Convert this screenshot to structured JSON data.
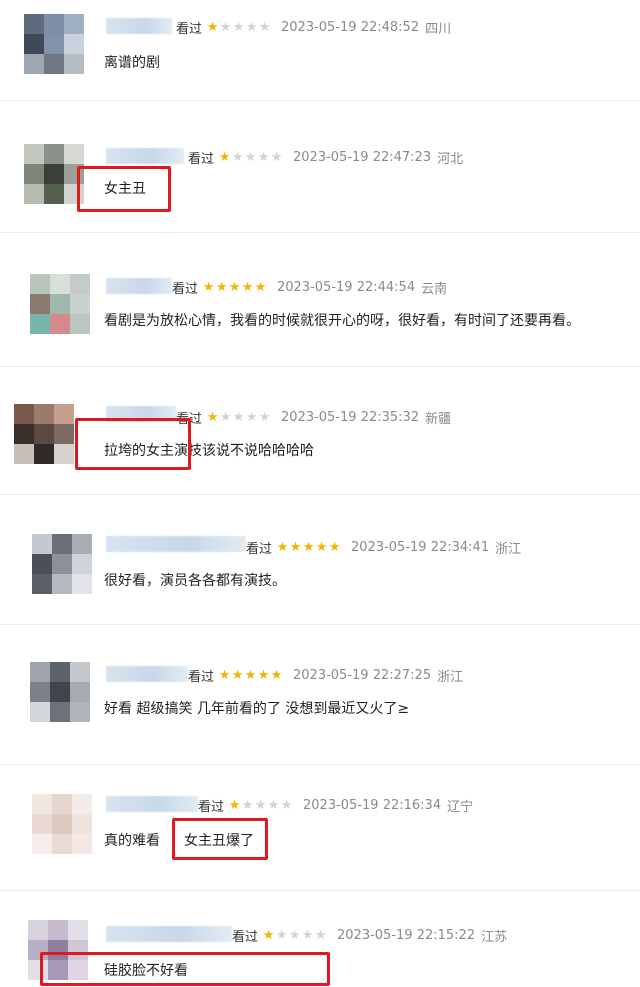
{
  "reviews": [
    {
      "watched": "看过",
      "stars": 1,
      "time": "2023-05-19 22:48:52",
      "location": "四川",
      "text": "离谱的剧",
      "avatar": [
        "#5e6b7c",
        "#7d8ea6",
        "#a2b0c4",
        "#3f4a59",
        "#8093aa",
        "#c8d1dc",
        "#9fa8b2",
        "#6f7882",
        "#b5bcc4"
      ]
    },
    {
      "watched": "看过",
      "stars": 1,
      "time": "2023-05-19 22:47:23",
      "location": "河北",
      "text": "女主丑",
      "avatar": [
        "#c2c8bf",
        "#8c928a",
        "#d6d9d3",
        "#7e8678",
        "#3b3f38",
        "#9aa096",
        "#b7bdb2",
        "#556051",
        "#d0d4cc"
      ]
    },
    {
      "watched": "看过",
      "stars": 5,
      "time": "2023-05-19 22:44:54",
      "location": "云南",
      "text": "看剧是为放松心情，我看的时候就很开心的呀，很好看，有时间了还要再看。",
      "avatar": [
        "#b7c6bd",
        "#d7dfd9",
        "#c3ccc6",
        "#8a7a6e",
        "#9fb7ad",
        "#c9d3cd",
        "#78b5ad",
        "#d58a8e",
        "#bcc6c0"
      ]
    },
    {
      "watched": "看过",
      "stars": 1,
      "time": "2023-05-19 22:35:32",
      "location": "新疆",
      "text": "拉垮的女主演技该说不说哈哈哈哈",
      "avatar": [
        "#7a5a4c",
        "#9b7b6a",
        "#c6a08f",
        "#3a2e2b",
        "#5b4a44",
        "#7d6a62",
        "#c9bfb8",
        "#2f2a29",
        "#d7d2cf"
      ]
    },
    {
      "watched": "看过",
      "stars": 5,
      "time": "2023-05-19 22:34:41",
      "location": "浙江",
      "text": "很好看，演员各各都有演技。",
      "avatar": [
        "#c5c9cf",
        "#6b7078",
        "#a9aeb5",
        "#4a4f57",
        "#8c9199",
        "#d0d3d7",
        "#5a5f66",
        "#b6bac0",
        "#e1e3e6"
      ]
    },
    {
      "watched": "看过",
      "stars": 5,
      "time": "2023-05-19 22:27:25",
      "location": "浙江",
      "text": "好看 超级搞笑 几年前看的了 没想到最近又火了≥",
      "avatar": [
        "#9ea4aa",
        "#5d636a",
        "#c4c8cc",
        "#7b8187",
        "#3f454b",
        "#a6abb0",
        "#d4d7da",
        "#6c7278",
        "#b1b5b9"
      ]
    },
    {
      "watched": "看过",
      "stars": 1,
      "time": "2023-05-19 22:16:34",
      "location": "辽宁",
      "text": "真的难看",
      "text2": "女主丑爆了",
      "avatar": [
        "#f0e6e2",
        "#e6d6d0",
        "#f4ece9",
        "#e9d9d2",
        "#dfcac2",
        "#efe3de",
        "#f5eeeb",
        "#e8dbd6",
        "#f2e9e5"
      ]
    },
    {
      "watched": "看过",
      "stars": 1,
      "time": "2023-05-19 22:15:22",
      "location": "江苏",
      "text": "硅胶脸不好看",
      "avatar": [
        "#d8d2dd",
        "#c5bccd",
        "#e3dee7",
        "#b9aec4",
        "#8f7fa0",
        "#cfc6d6",
        "#e4dfe8",
        "#a898b5",
        "#ddd6e2"
      ]
    }
  ]
}
